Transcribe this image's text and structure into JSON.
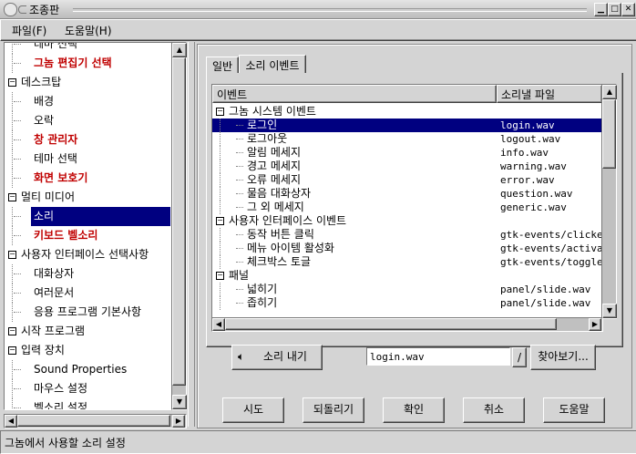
{
  "window": {
    "title": "조종판"
  },
  "menubar": {
    "file": "파일(F)",
    "help": "도움말(H)"
  },
  "tree": {
    "items": [
      {
        "label": "테마 선택",
        "level": 1,
        "style": "normal"
      },
      {
        "label": "그놈 편집기 선택",
        "level": 1,
        "style": "red"
      },
      {
        "label": "데스크탑",
        "level": 0,
        "style": "normal"
      },
      {
        "label": "배경",
        "level": 1,
        "style": "normal"
      },
      {
        "label": "오락",
        "level": 1,
        "style": "normal"
      },
      {
        "label": "창 관리자",
        "level": 1,
        "style": "red"
      },
      {
        "label": "테마 선택",
        "level": 1,
        "style": "normal"
      },
      {
        "label": "화면 보호기",
        "level": 1,
        "style": "red"
      },
      {
        "label": "멀티 미디어",
        "level": 0,
        "style": "normal"
      },
      {
        "label": "소리",
        "level": 1,
        "style": "selected"
      },
      {
        "label": "키보드 벨소리",
        "level": 1,
        "style": "red"
      },
      {
        "label": "사용자 인터페이스 선택사항",
        "level": 0,
        "style": "normal"
      },
      {
        "label": "대화상자",
        "level": 1,
        "style": "normal"
      },
      {
        "label": "여러문서",
        "level": 1,
        "style": "normal"
      },
      {
        "label": "응용 프로그램 기본사항",
        "level": 1,
        "style": "normal"
      },
      {
        "label": "시작 프로그램",
        "level": 0,
        "style": "normal"
      },
      {
        "label": "입력 장치",
        "level": 0,
        "style": "normal"
      },
      {
        "label": "Sound Properties",
        "level": 1,
        "style": "normal"
      },
      {
        "label": "마우스 설정",
        "level": 1,
        "style": "normal"
      },
      {
        "label": "벨소리 설정",
        "level": 1,
        "style": "normal"
      }
    ]
  },
  "tabs": {
    "general": "일반",
    "sound_events": "소리 이벤트"
  },
  "events_list": {
    "col_event": "이벤트",
    "col_file": "소리낼 파일",
    "rows": [
      {
        "event": "그놈 시스템 이벤트",
        "file": "",
        "group": true
      },
      {
        "event": "로그인",
        "file": "login.wav",
        "group": false
      },
      {
        "event": "로그아웃",
        "file": "logout.wav",
        "group": false
      },
      {
        "event": "알림 메세지",
        "file": "info.wav",
        "group": false
      },
      {
        "event": "경고 메세지",
        "file": "warning.wav",
        "group": false
      },
      {
        "event": "오류 메세지",
        "file": "error.wav",
        "group": false
      },
      {
        "event": "물음 대화상자",
        "file": "question.wav",
        "group": false
      },
      {
        "event": "그 외 메세지",
        "file": "generic.wav",
        "group": false
      },
      {
        "event": "사용자 인터페이스 이벤트",
        "file": "",
        "group": true
      },
      {
        "event": "동작 버튼 클릭",
        "file": "gtk-events/clicked",
        "group": false
      },
      {
        "event": "메뉴 아이템 활성화",
        "file": "gtk-events/activate",
        "group": false
      },
      {
        "event": "체크박스 토글",
        "file": "gtk-events/toggled",
        "group": false
      },
      {
        "event": "패널",
        "file": "",
        "group": true
      },
      {
        "event": "넓히기",
        "file": "panel/slide.wav",
        "group": false
      },
      {
        "event": "좁히기",
        "file": "panel/slide.wav",
        "group": false
      }
    ],
    "selected_index": 1
  },
  "play_button": {
    "label": "소리 내기"
  },
  "file_input": {
    "value": "login.wav"
  },
  "slash_button": {
    "label": "/"
  },
  "browse_button": {
    "label": "찾아보기..."
  },
  "bottom_buttons": {
    "try": "시도",
    "revert": "되돌리기",
    "ok": "확인",
    "cancel": "취소",
    "help": "도움말"
  },
  "statusbar": {
    "text": "그놈에서 사용할 소리 설정"
  }
}
